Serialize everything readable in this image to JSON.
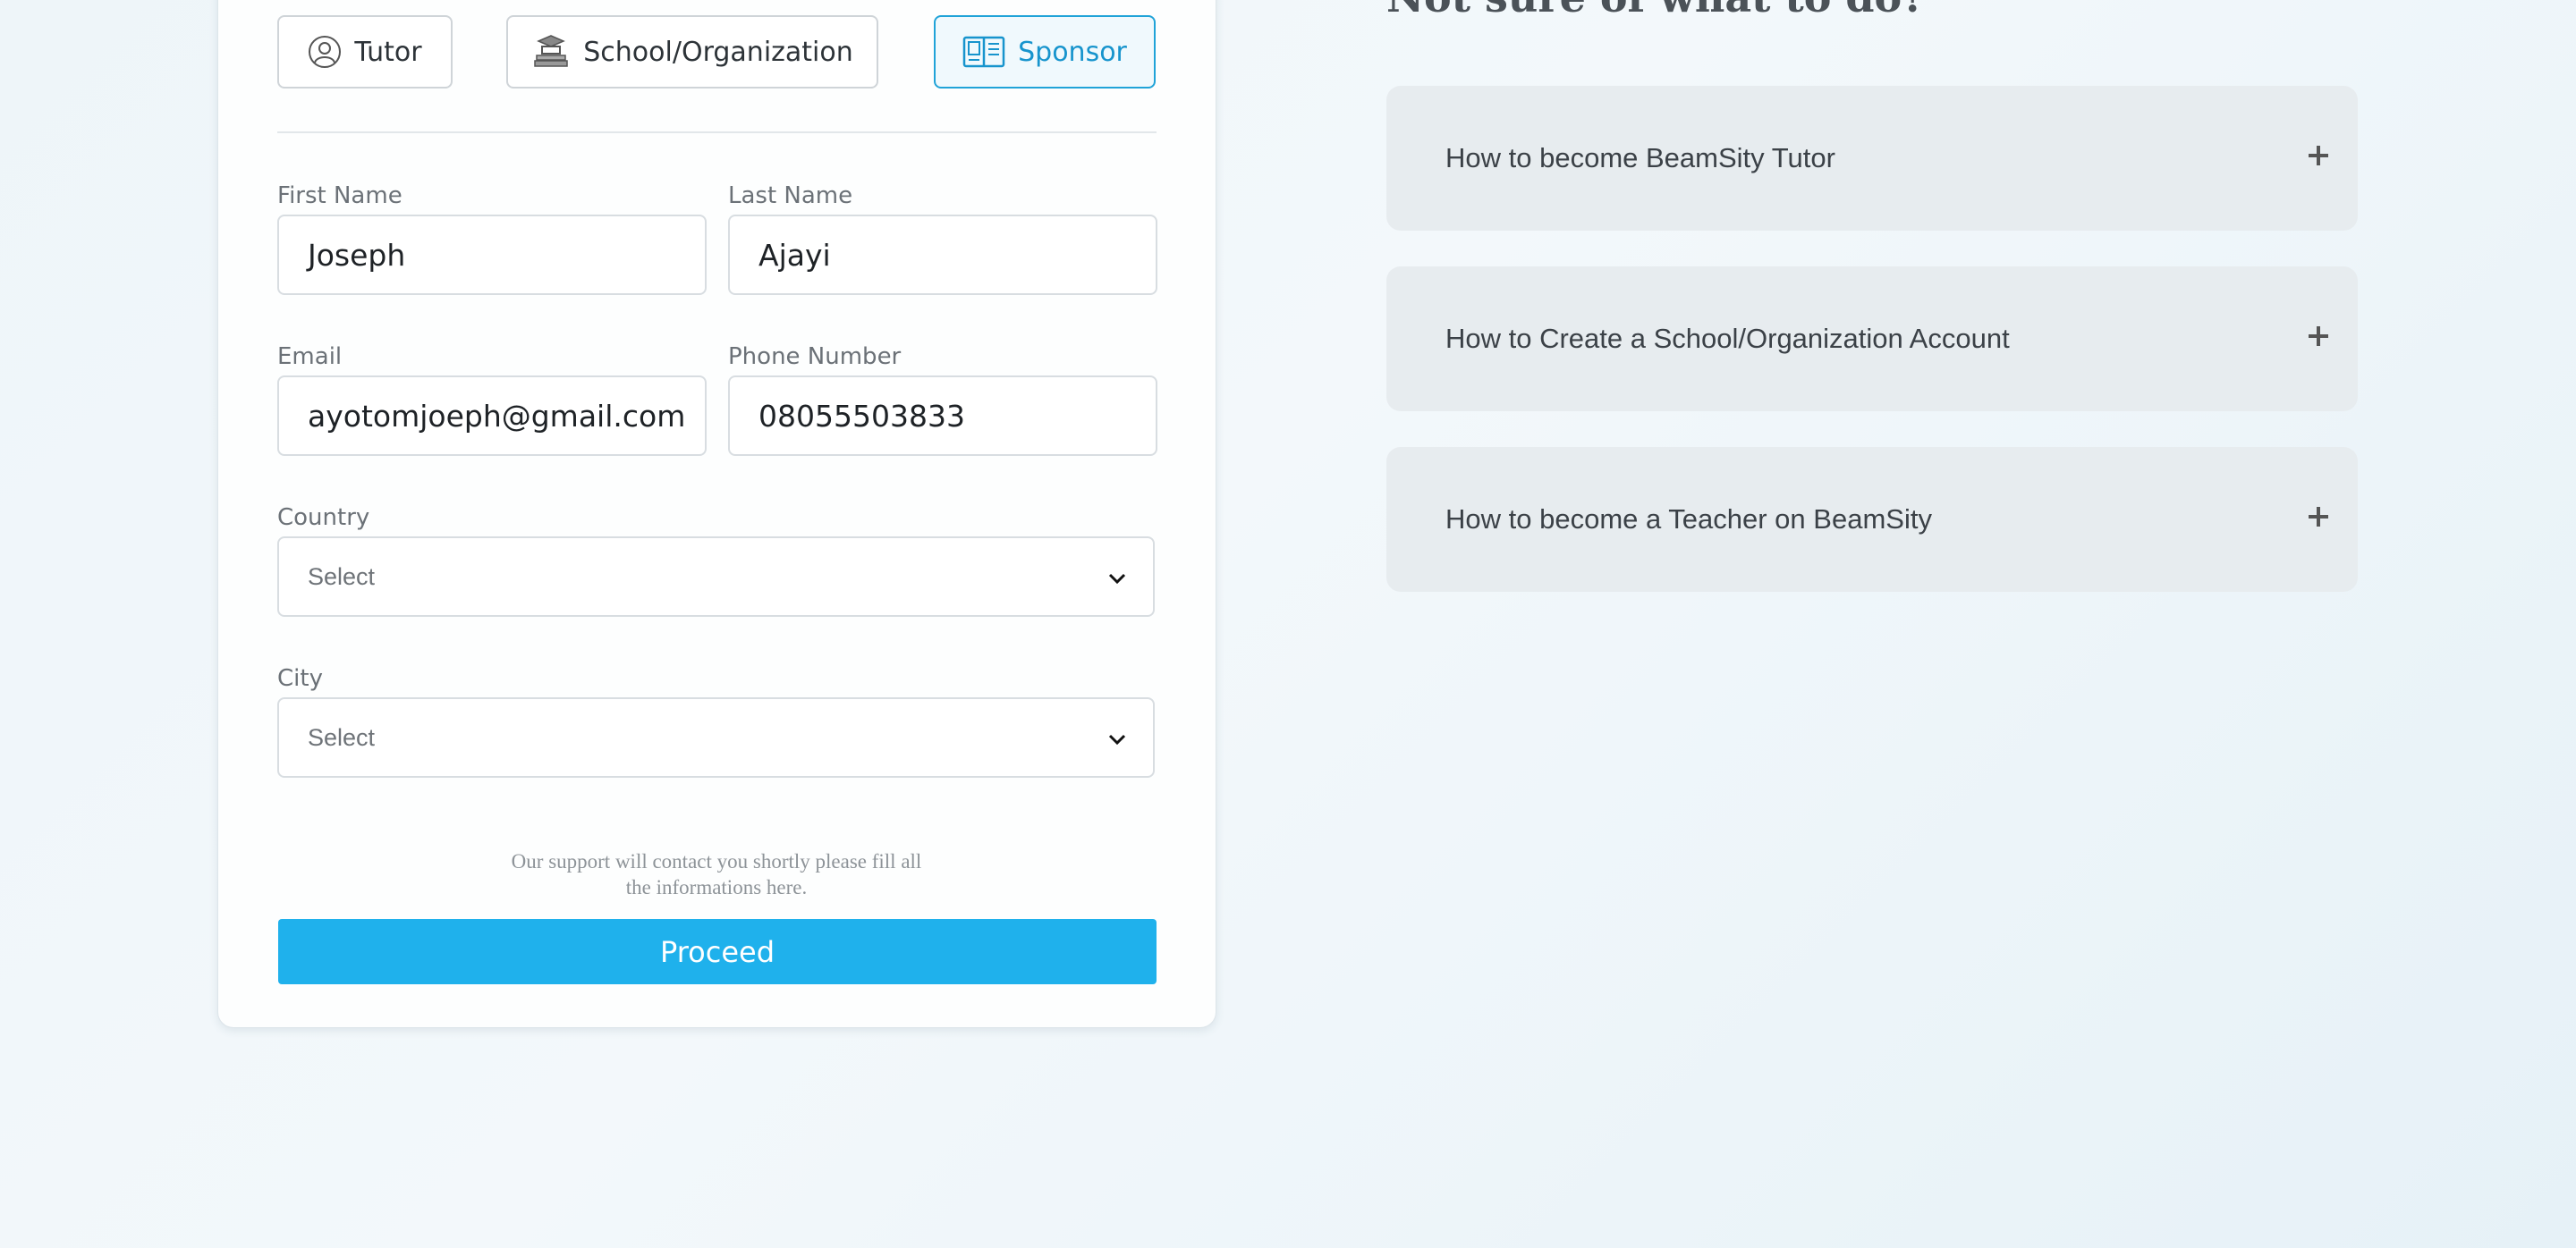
{
  "account_types": [
    {
      "label": "Tutor",
      "icon": "tutor-avatar-icon",
      "active": false
    },
    {
      "label": "School/Organization",
      "icon": "school-icon",
      "active": false
    },
    {
      "label": "Sponsor",
      "icon": "sponsor-book-icon",
      "active": true
    }
  ],
  "form": {
    "first_name": {
      "label": "First Name",
      "value": "Joseph"
    },
    "last_name": {
      "label": "Last Name",
      "value": "Ajayi"
    },
    "email": {
      "label": "Email",
      "value": "ayotomjoeph@gmail.com"
    },
    "phone": {
      "label": "Phone Number",
      "value": "08055503833"
    },
    "country": {
      "label": "Country",
      "value": "Select"
    },
    "city": {
      "label": "City",
      "value": "Select"
    },
    "note_line1": "Our support will contact you shortly please fill all",
    "note_line2": "the informations here.",
    "submit_label": "Proceed"
  },
  "faq": {
    "title": "Not sure of what to do?",
    "items": [
      {
        "question": "How to become BeamSity Tutor"
      },
      {
        "question": "How to Create a School/Organization Account"
      },
      {
        "question": "How to become a Teacher on BeamSity"
      }
    ]
  },
  "colors": {
    "accent": "#1fb1ec",
    "active_border": "#20a3d8"
  }
}
